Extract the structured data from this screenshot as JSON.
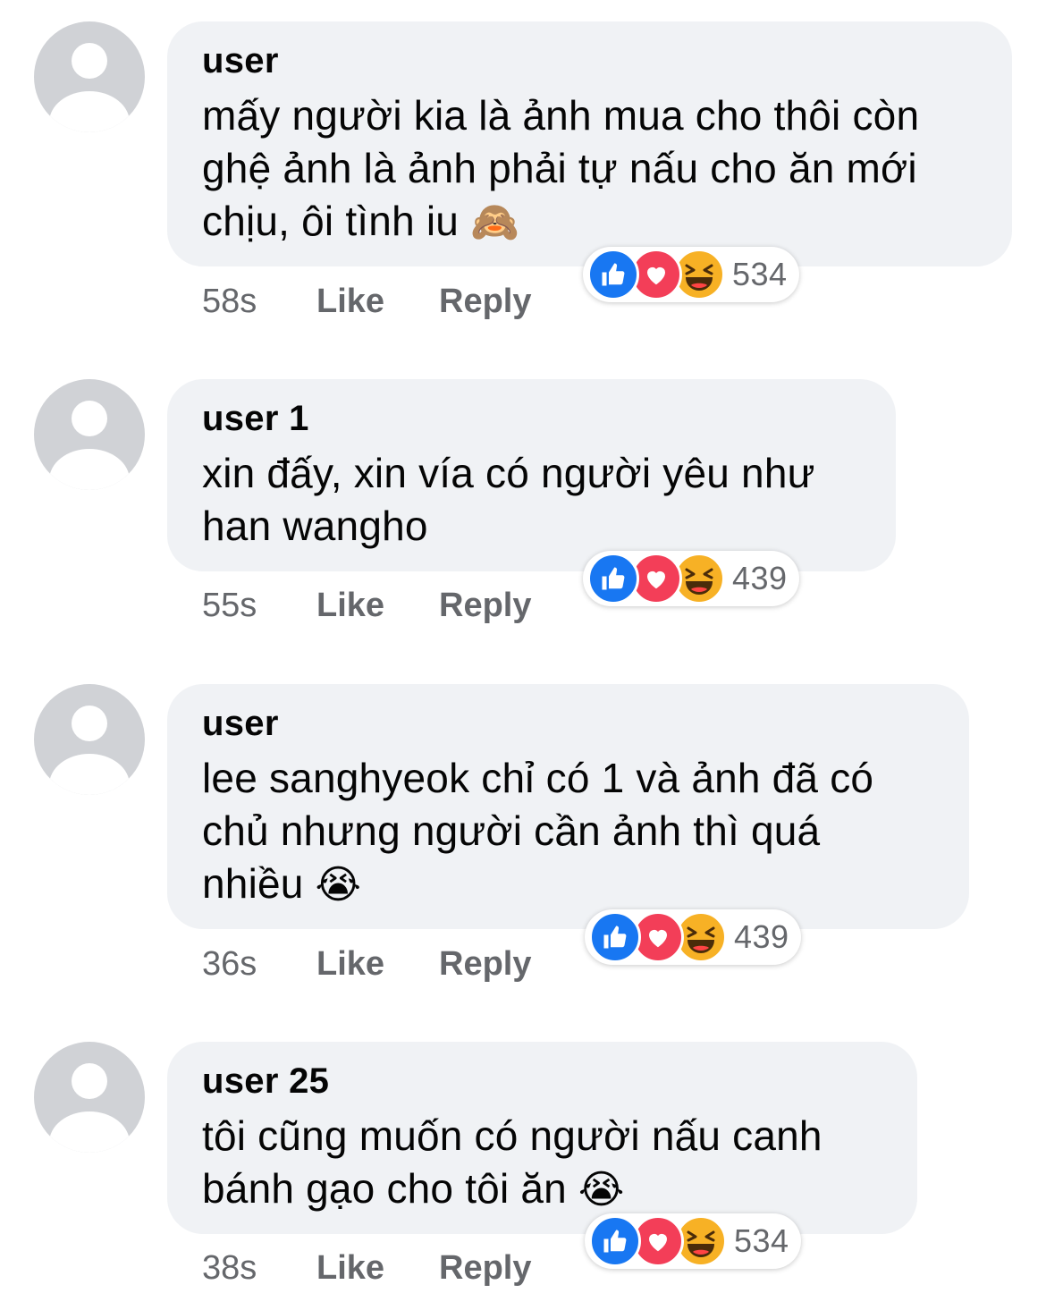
{
  "comments": [
    {
      "author": "user",
      "text": "mấy người kia là ảnh mua cho thôi còn\nghệ ảnh là ảnh phải tự nấu cho ăn mới\nchịu, ôi tình iu ",
      "emoji": "🙈",
      "time": "58s",
      "like_label": "Like",
      "reply_label": "Reply",
      "reaction_count": "534"
    },
    {
      "author": "user 1",
      "text": "xin đấy, xin vía có người yêu như\nhan wangho",
      "emoji": "",
      "time": "55s",
      "like_label": "Like",
      "reply_label": "Reply",
      "reaction_count": "439"
    },
    {
      "author": "user",
      "text": "lee sanghyeok chỉ có 1 và ảnh đã có\nchủ nhưng người cần ảnh thì quá\nnhiều ",
      "emoji": "😭",
      "time": "36s",
      "like_label": "Like",
      "reply_label": "Reply",
      "reaction_count": "439"
    },
    {
      "author": "user 25",
      "text": "tôi cũng muốn có người nấu canh\nbánh gạo cho tôi ăn ",
      "emoji": "😭",
      "time": "38s",
      "like_label": "Like",
      "reply_label": "Reply",
      "reaction_count": "534"
    }
  ],
  "reaction_icons": [
    "like-icon",
    "love-icon",
    "haha-icon"
  ],
  "colors": {
    "bubble": "#f0f2f5",
    "meta_text": "#65676b",
    "like": "#1877f2",
    "love": "#f33e58",
    "haha": "#f7b125",
    "avatar": "#d0d2d6"
  }
}
